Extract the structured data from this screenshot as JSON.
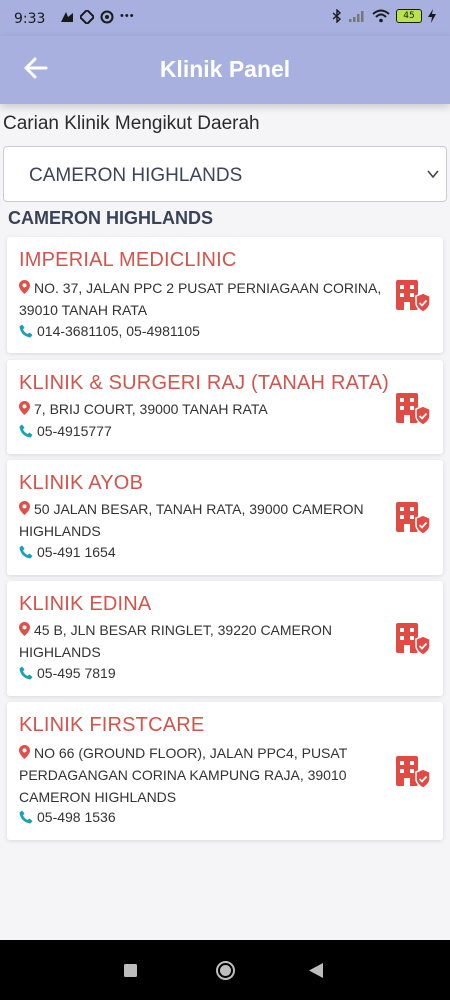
{
  "status": {
    "time": "9:33",
    "dots": "•••",
    "battery": "45",
    "left_icons": [
      "notification-icon",
      "sync-icon",
      "app-icon"
    ],
    "right_icons": [
      "bluetooth-icon",
      "signal-icon",
      "wifi-icon",
      "battery-icon",
      "charging-icon"
    ]
  },
  "app_bar": {
    "title": "Klinik Panel",
    "back_icon": "arrow-left-icon"
  },
  "search": {
    "label": "Carian Klinik Mengikut Daerah",
    "selected": "CAMERON HIGHLANDS"
  },
  "region": "CAMERON HIGHLANDS",
  "colors": {
    "header": "#a7b0de",
    "clinic_name": "#d4534b",
    "pin": "#e05048",
    "phone": "#17a2b8",
    "clinic_icon": "#e24a44"
  },
  "clinics": [
    {
      "name": "IMPERIAL MEDICLINIC",
      "address_lines": [
        "NO. 37, JALAN PPC 2 PUSAT PERNIAGAAN CORINA,",
        "39010 TANAH RATA"
      ],
      "phone": "014-3681105, 05-4981105"
    },
    {
      "name": "KLINIK & SURGERI RAJ (TANAH RATA)",
      "address_lines": [
        "7, BRIJ COURT, 39000 TANAH RATA"
      ],
      "phone": "05-4915777"
    },
    {
      "name": "KLINIK AYOB",
      "address_lines": [
        "50 JALAN BESAR, TANAH RATA, 39000 CAMERON",
        "HIGHLANDS"
      ],
      "phone": "05-491 1654"
    },
    {
      "name": "KLINIK EDINA",
      "address_lines": [
        "45 B, JLN BESAR RINGLET, 39220 CAMERON",
        "HIGHLANDS"
      ],
      "phone": "05-495 7819"
    },
    {
      "name": "KLINIK FIRSTCARE",
      "address_lines": [
        "NO 66 (GROUND FLOOR), JALAN PPC4, PUSAT",
        "PERDAGANGAN CORINA KAMPUNG RAJA, 39010",
        "CAMERON HIGHLANDS"
      ],
      "phone": "05-498 1536"
    }
  ],
  "nav": {
    "icons": [
      "recents-square-icon",
      "home-circle-icon",
      "back-triangle-icon"
    ]
  }
}
